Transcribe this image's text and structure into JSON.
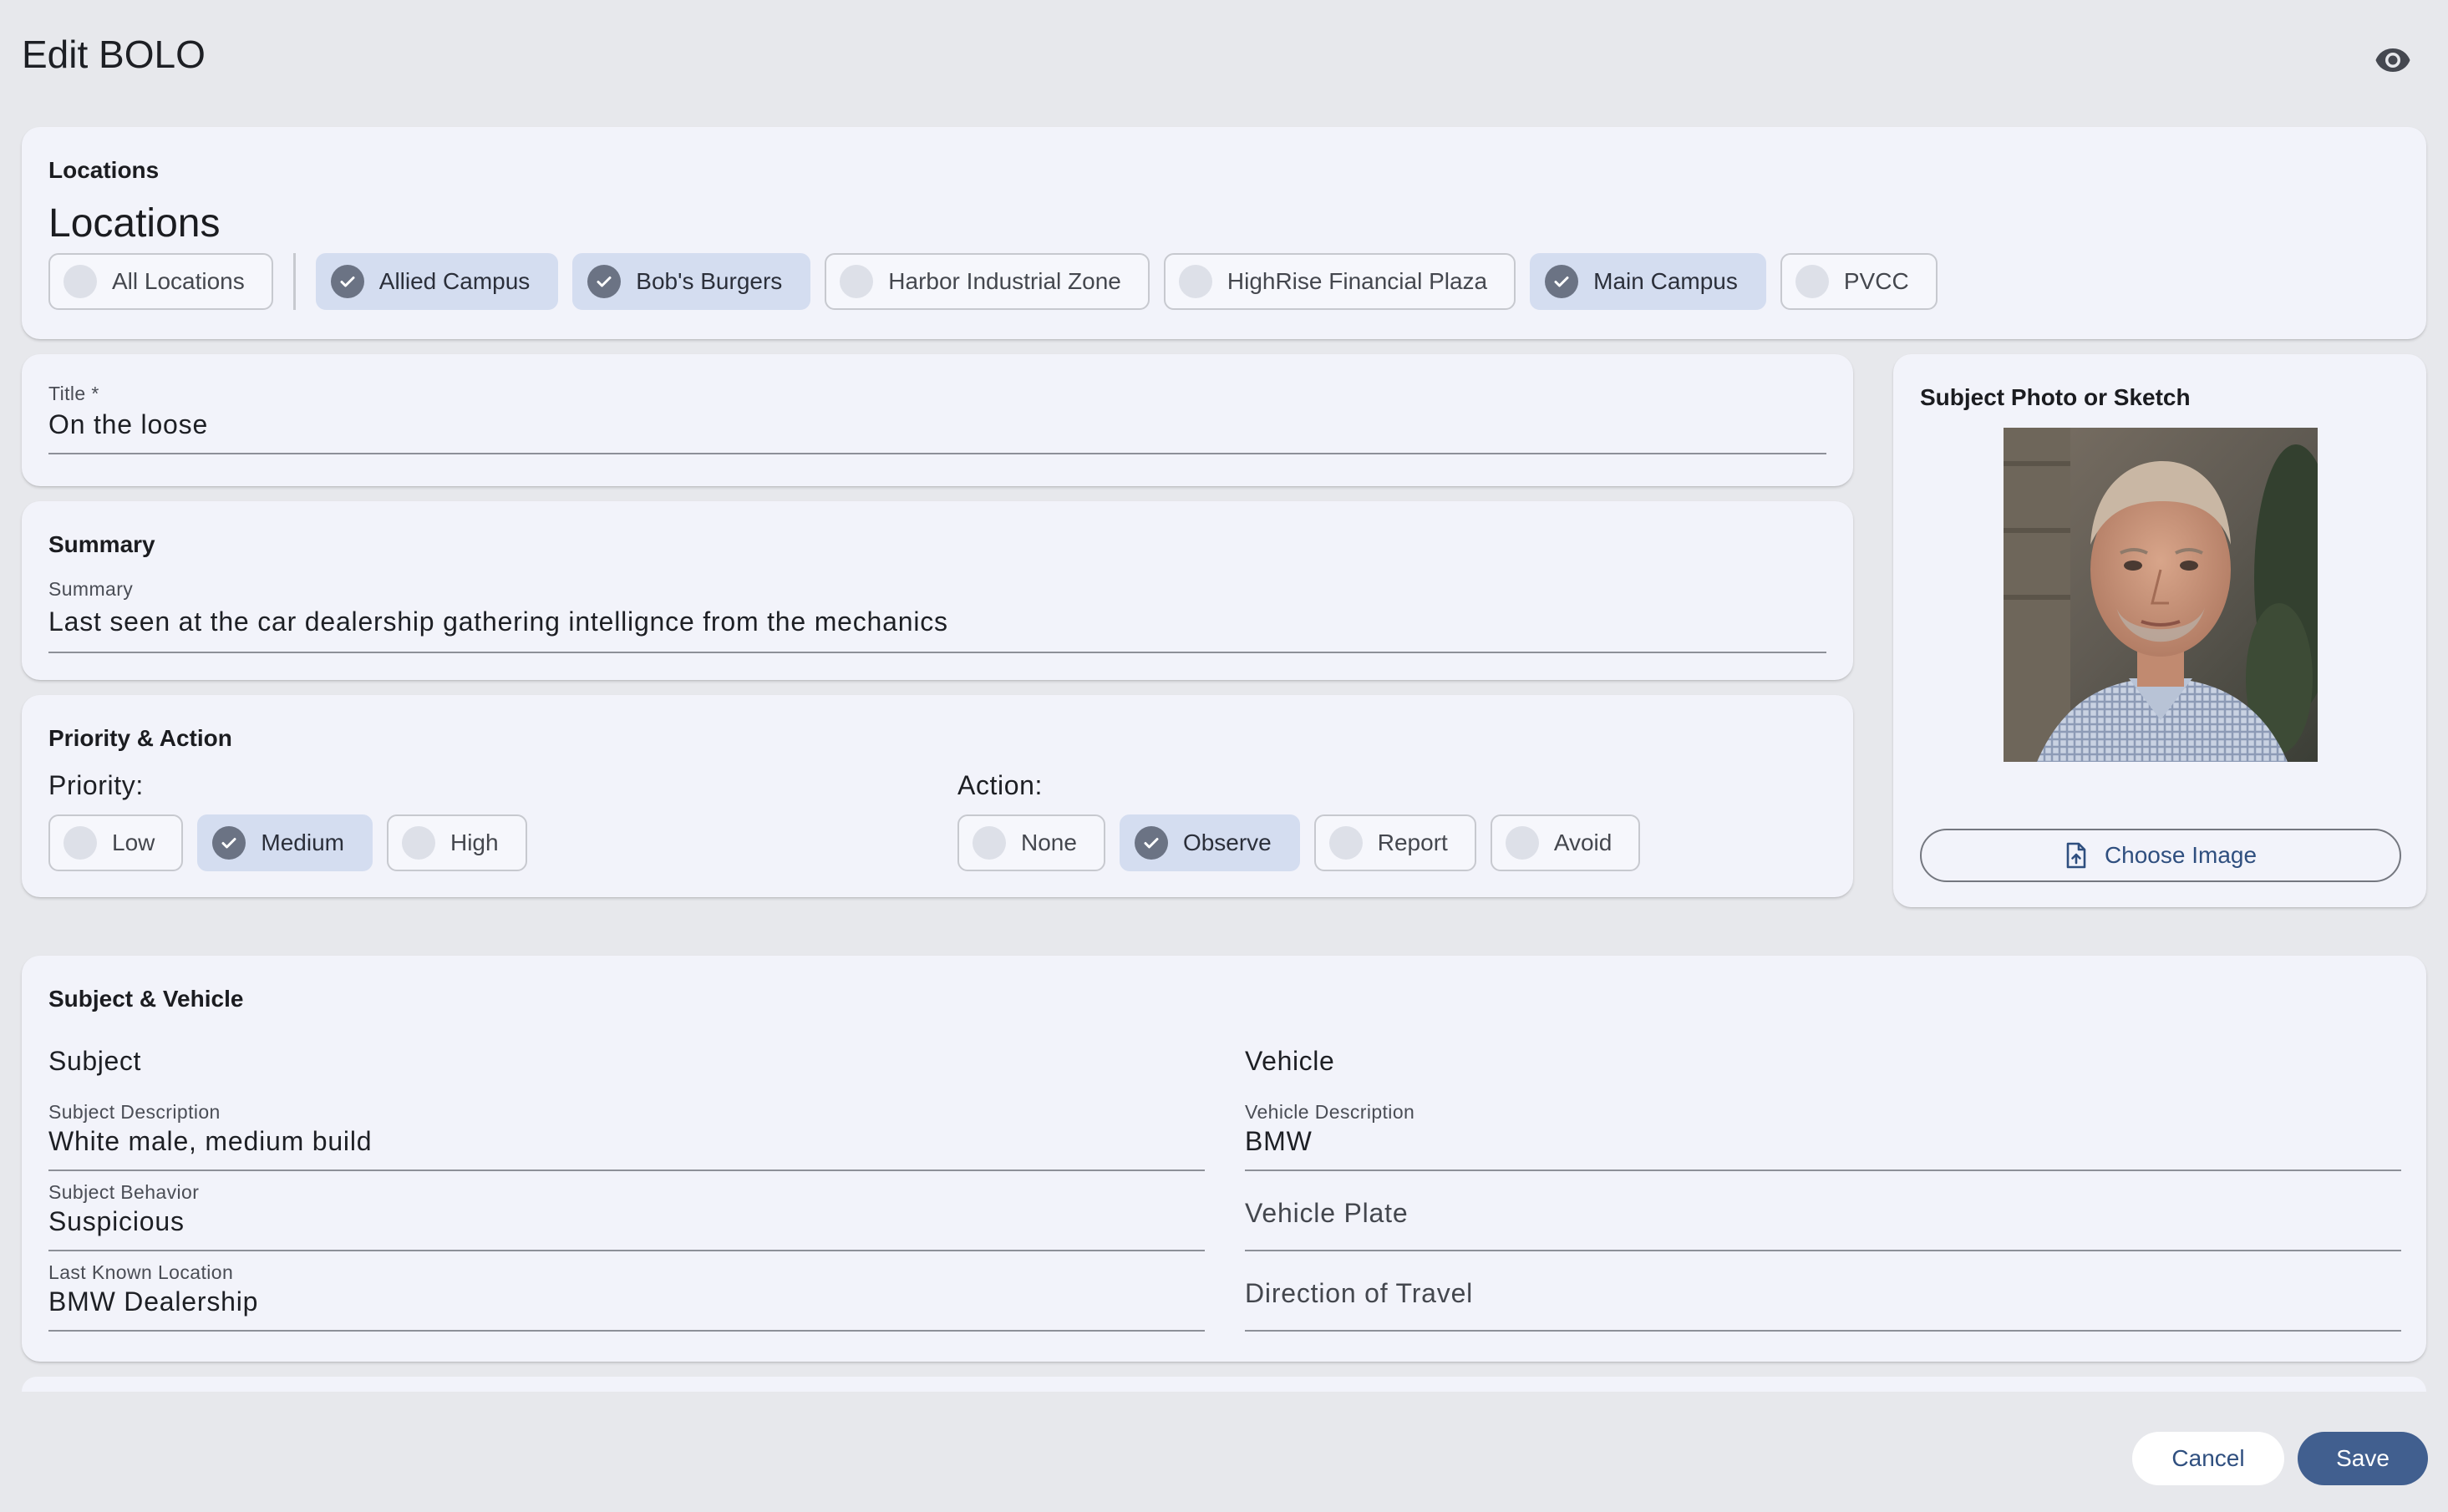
{
  "page": {
    "title": "Edit BOLO",
    "preview_icon": "eye-icon"
  },
  "locations": {
    "card_title": "Locations",
    "heading": "Locations",
    "all_label": "All Locations",
    "all_selected": false,
    "chips": [
      {
        "label": "Allied Campus",
        "selected": true
      },
      {
        "label": "Bob's Burgers",
        "selected": true
      },
      {
        "label": "Harbor Industrial Zone",
        "selected": false
      },
      {
        "label": "HighRise Financial Plaza",
        "selected": false
      },
      {
        "label": "Main Campus",
        "selected": true
      },
      {
        "label": "PVCC",
        "selected": false
      }
    ]
  },
  "title_field": {
    "label": "Title *",
    "value": "On the loose"
  },
  "summary": {
    "card_title": "Summary",
    "label": "Summary",
    "value": "Last seen at the car dealership gathering intellignce from the mechanics"
  },
  "priority_action": {
    "card_title": "Priority & Action",
    "priority_label": "Priority:",
    "priority_options": [
      {
        "label": "Low",
        "selected": false
      },
      {
        "label": "Medium",
        "selected": true
      },
      {
        "label": "High",
        "selected": false
      }
    ],
    "action_label": "Action:",
    "action_options": [
      {
        "label": "None",
        "selected": false
      },
      {
        "label": "Observe",
        "selected": true
      },
      {
        "label": "Report",
        "selected": false
      },
      {
        "label": "Avoid",
        "selected": false
      }
    ]
  },
  "photo": {
    "card_title": "Subject Photo or Sketch",
    "choose_button": "Choose Image",
    "choose_icon": "file-upload-icon"
  },
  "subject_vehicle": {
    "card_title": "Subject & Vehicle",
    "subject_heading": "Subject",
    "vehicle_heading": "Vehicle",
    "subject_description": {
      "label": "Subject Description",
      "value": "White male, medium build"
    },
    "subject_behavior": {
      "label": "Subject Behavior",
      "value": "Suspicious"
    },
    "last_known_location": {
      "label": "Last Known Location",
      "value": "BMW Dealership"
    },
    "vehicle_description": {
      "label": "Vehicle Description",
      "value": "BMW"
    },
    "vehicle_plate": {
      "placeholder": "Vehicle Plate"
    },
    "direction_of_travel": {
      "placeholder": "Direction of Travel"
    }
  },
  "footer": {
    "cancel": "Cancel",
    "save": "Save"
  },
  "colors": {
    "background": "#e7e8ec",
    "card": "#f2f3fa",
    "chip_selected": "#d4ddf0",
    "primary": "#415f8f",
    "check_circle": "#6b7384"
  }
}
